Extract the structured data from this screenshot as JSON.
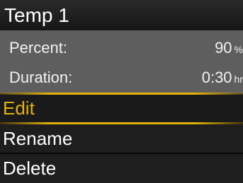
{
  "title": "Temp 1",
  "info": {
    "percent": {
      "label": "Percent:",
      "value": "90",
      "unit": "%"
    },
    "duration": {
      "label": "Duration:",
      "value": "0:30",
      "unit": "hr"
    }
  },
  "menu": {
    "items": [
      {
        "label": "Edit",
        "selected": true
      },
      {
        "label": "Rename",
        "selected": false
      },
      {
        "label": "Delete",
        "selected": false
      }
    ],
    "highlight_color": "#e3b20a"
  }
}
